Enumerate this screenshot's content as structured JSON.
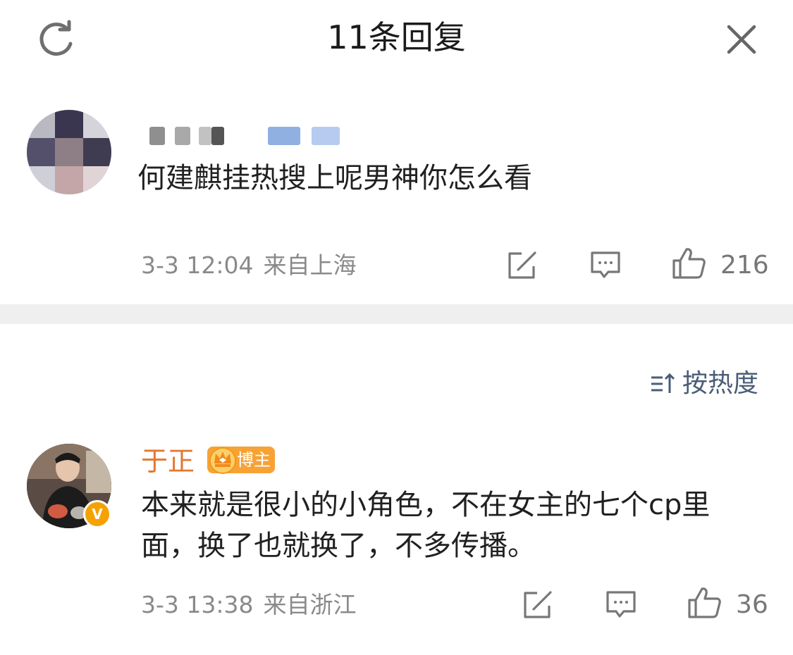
{
  "header": {
    "title": "11条回复",
    "refresh_icon": "refresh-icon",
    "close_icon": "close-icon"
  },
  "main_comment": {
    "text": "何建麒挂热搜上呢男神你怎么看",
    "time": "3-3 12:04",
    "location": "来自上海",
    "likes": "216",
    "icons": [
      "share-icon",
      "comment-icon",
      "like-icon"
    ]
  },
  "sort": {
    "label": "按热度",
    "icon": "sort-icon"
  },
  "reply": {
    "username": "于正",
    "badge": "博主",
    "verified_mark": "V",
    "text": "本来就是很小的小角色，不在女主的七个cp里面，换了也就换了，不多传播。",
    "time": "3-3 13:38",
    "location": "来自浙江",
    "likes": "36",
    "colors": {
      "username": "#e4772e",
      "badge": "#f7a235",
      "verified": "#f5a100"
    }
  },
  "colors": {
    "sort_text": "#4a5d78",
    "meta_text": "#8a8a8a",
    "divider": "#efefef"
  }
}
